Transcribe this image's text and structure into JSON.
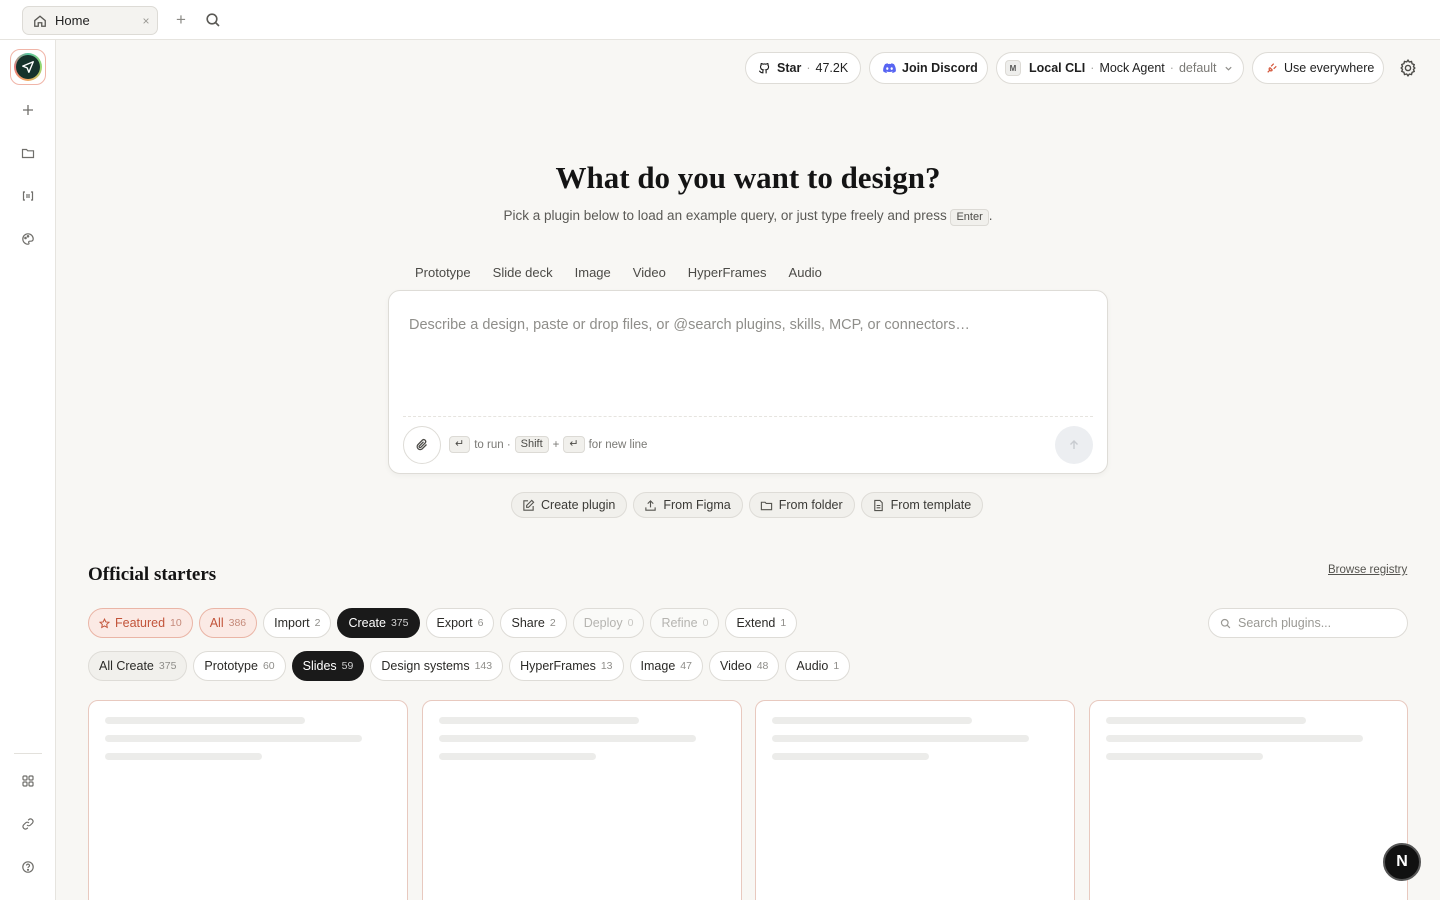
{
  "tabbar": {
    "home_tab_label": "Home",
    "close_glyph": "×",
    "add_glyph": "+"
  },
  "sidebar": {
    "items": [
      {
        "icon": "plus-icon"
      },
      {
        "icon": "folder-icon"
      },
      {
        "icon": "brackets-icon"
      },
      {
        "icon": "palette-icon"
      },
      {
        "icon": "grid-icon"
      },
      {
        "icon": "link-icon"
      },
      {
        "icon": "help-icon"
      }
    ]
  },
  "header": {
    "star_label": "Star",
    "star_count": "47.2K",
    "discord_label": "Join Discord",
    "agent_badge": "M",
    "agent_source": "Local CLI",
    "agent_name": "Mock Agent",
    "agent_profile": "default",
    "use_everywhere_label": "Use everywhere"
  },
  "hero": {
    "title": "What do you want to design?",
    "subtitle_before": "Pick a plugin below to load an example query, or just type freely and press",
    "subtitle_key": "Enter",
    "subtitle_after": "."
  },
  "mode_tabs": [
    "Prototype",
    "Slide deck",
    "Image",
    "Video",
    "HyperFrames",
    "Audio"
  ],
  "composer": {
    "placeholder": "Describe a design, paste or drop files, or @search plugins, skills, MCP, or connectors…",
    "hint_key_enter": "↵",
    "hint_run": "to run ·",
    "hint_key_shift": "Shift",
    "hint_plus": "+",
    "hint_new_line": "for new line"
  },
  "actions": [
    {
      "label": "Create plugin",
      "icon": "edit-icon"
    },
    {
      "label": "From Figma",
      "icon": "upload-icon"
    },
    {
      "label": "From folder",
      "icon": "folder-icon"
    },
    {
      "label": "From template",
      "icon": "template-icon"
    }
  ],
  "starters": {
    "title": "Official starters",
    "browse_label": "Browse registry",
    "search_placeholder": "Search plugins...",
    "categories": [
      {
        "label": "Featured",
        "count": "10",
        "style": "featured"
      },
      {
        "label": "All",
        "count": "386",
        "style": "all"
      },
      {
        "label": "Import",
        "count": "2",
        "style": ""
      },
      {
        "label": "Create",
        "count": "375",
        "style": "active"
      },
      {
        "label": "Export",
        "count": "6",
        "style": ""
      },
      {
        "label": "Share",
        "count": "2",
        "style": ""
      },
      {
        "label": "Deploy",
        "count": "0",
        "style": "disabled"
      },
      {
        "label": "Refine",
        "count": "0",
        "style": "disabled"
      },
      {
        "label": "Extend",
        "count": "1",
        "style": ""
      }
    ],
    "subcategories": [
      {
        "label": "All Create",
        "count": "375",
        "style": "soft"
      },
      {
        "label": "Prototype",
        "count": "60",
        "style": ""
      },
      {
        "label": "Slides",
        "count": "59",
        "style": "active"
      },
      {
        "label": "Design systems",
        "count": "143",
        "style": ""
      },
      {
        "label": "HyperFrames",
        "count": "13",
        "style": ""
      },
      {
        "label": "Image",
        "count": "47",
        "style": ""
      },
      {
        "label": "Video",
        "count": "48",
        "style": ""
      },
      {
        "label": "Audio",
        "count": "1",
        "style": ""
      }
    ]
  },
  "next_badge": "N"
}
